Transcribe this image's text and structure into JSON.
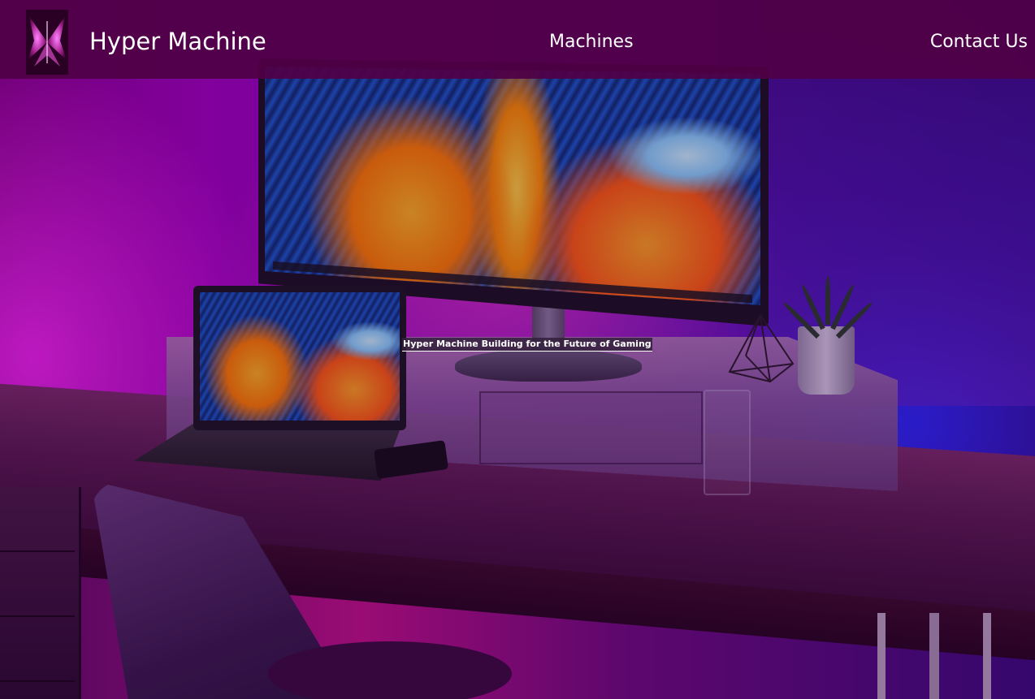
{
  "site": {
    "brand": "Hyper Machine",
    "logo_icon": "butterfly-logo-icon"
  },
  "nav": {
    "machines_label": "Machines",
    "contact_label": "Contact Us"
  },
  "hero": {
    "tagline": "Hyper Machine Building for the Future of Gaming",
    "image_desc_icon": "desk-setup-hero-image"
  },
  "colors": {
    "navbar_bg": "#50003f",
    "text": "#ffffff",
    "accent_magenta": "#c010a0",
    "accent_blue": "#3030ff"
  }
}
